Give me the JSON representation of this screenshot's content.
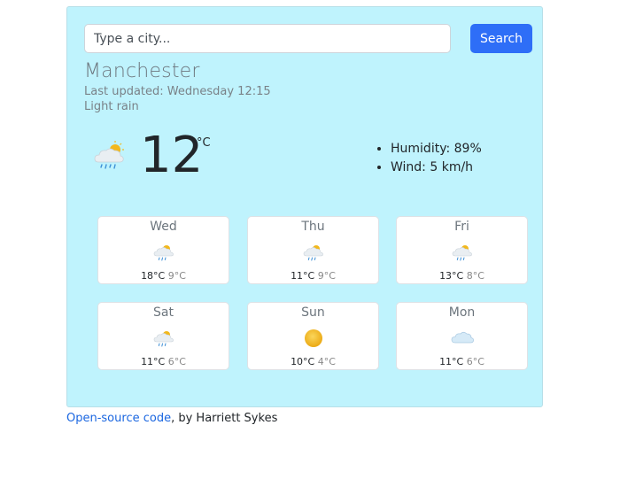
{
  "search": {
    "placeholder": "Type a city...",
    "value": "",
    "button_label": "Search"
  },
  "current": {
    "city": "Manchester",
    "last_updated": "Last updated: Wednesday 12:15",
    "description": "Light rain",
    "temperature": "12",
    "unit": "°C",
    "icon": "light-rain-icon",
    "details": [
      "Humidity: 89%",
      "Wind: 5 km/h"
    ]
  },
  "forecast": [
    {
      "day": "Wed",
      "max": "18°C",
      "min": "9°C",
      "icon": "light-rain-icon"
    },
    {
      "day": "Thu",
      "max": "11°C",
      "min": "9°C",
      "icon": "light-rain-icon"
    },
    {
      "day": "Fri",
      "max": "13°C",
      "min": "8°C",
      "icon": "light-rain-icon"
    },
    {
      "day": "Sat",
      "max": "11°C",
      "min": "6°C",
      "icon": "light-rain-icon"
    },
    {
      "day": "Sun",
      "max": "10°C",
      "min": "4°C",
      "icon": "sun-icon"
    },
    {
      "day": "Mon",
      "max": "11°C",
      "min": "6°C",
      "icon": "cloud-icon"
    }
  ],
  "footer": {
    "link_text": "Open-source code",
    "suffix": ", by Harriett Sykes"
  },
  "colors": {
    "card_background": "#bff3fd",
    "accent": "#2e6ef7",
    "link": "#1a66e0",
    "sun": "#f2b81c"
  }
}
